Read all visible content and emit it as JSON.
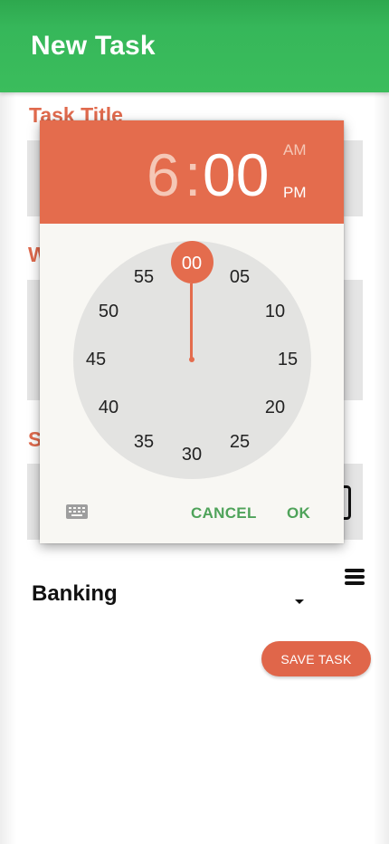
{
  "app_bar": {
    "title": "New Task"
  },
  "form": {
    "task_title_label": "Task Title",
    "second_label_initial": "W",
    "third_label_initial": "S",
    "category_value": "Banking",
    "save_button_label": "SAVE TASK"
  },
  "time_picker": {
    "hour": "6",
    "separator": ":",
    "minute": "00",
    "am_label": "AM",
    "pm_label": "PM",
    "selected_period": "PM",
    "selected_minute": "00",
    "minute_labels": [
      "00",
      "05",
      "10",
      "15",
      "20",
      "25",
      "30",
      "35",
      "40",
      "45",
      "50",
      "55"
    ],
    "cancel_label": "CANCEL",
    "ok_label": "OK"
  },
  "colors": {
    "app_bar": "#3bbd5c",
    "accent": "#e46c4d",
    "button_text": "#4fa35a"
  },
  "icons": [
    "keyboard-icon",
    "calendar-icon",
    "menu-icon",
    "dropdown-arrow-icon"
  ]
}
